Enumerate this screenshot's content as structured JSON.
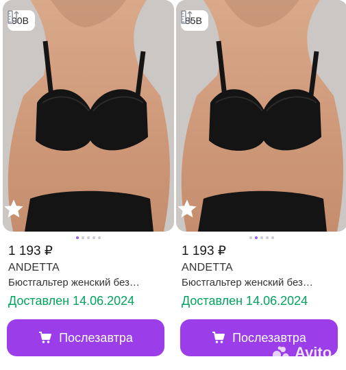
{
  "cards": [
    {
      "size_label": "90B",
      "price": "1 193 ₽",
      "brand": "ANDETTA",
      "title": "Бюстгальтер женский без…",
      "delivery": "Доставлен 14.06.2024",
      "button_label": "Послезавтра",
      "gallery_dots": 5,
      "active_dot": 0
    },
    {
      "size_label": "85B",
      "price": "1 193 ₽",
      "brand": "ANDETTA",
      "title": "Бюстгальтер женский без…",
      "delivery": "Доставлен 14.06.2024",
      "button_label": "Послезавтра",
      "gallery_dots": 5,
      "active_dot": 1
    }
  ],
  "watermark": "Avito",
  "colors": {
    "accent": "#9b3de8",
    "delivery_green": "#02a35e",
    "dot_active": "#965eeb"
  },
  "icons": {
    "size": "ruler-icon",
    "rating": "star-icon",
    "cart": "cart-icon"
  }
}
